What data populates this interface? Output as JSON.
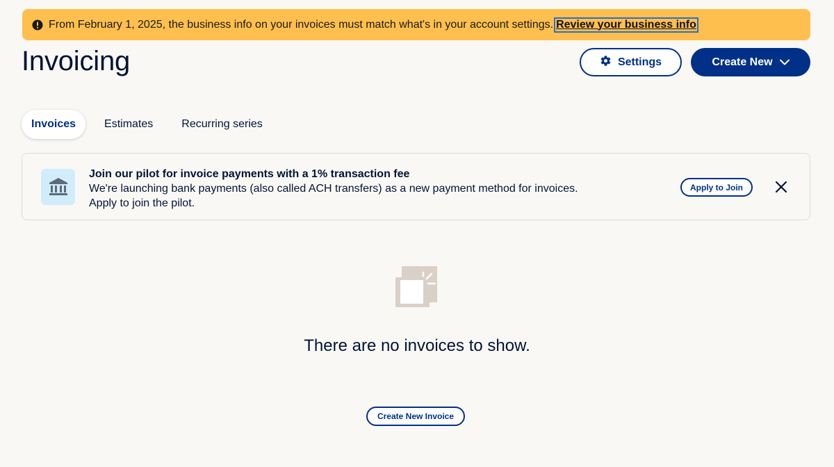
{
  "alert": {
    "message": "From February 1, 2025, the business info on your invoices must match what's in your account settings.",
    "link_label": "Review your business info",
    "icon": "exclamation-circle-icon"
  },
  "header": {
    "title": "Invoicing",
    "settings_label": "Settings",
    "create_label": "Create New"
  },
  "tabs": [
    {
      "label": "Invoices",
      "active": true
    },
    {
      "label": "Estimates",
      "active": false
    },
    {
      "label": "Recurring series",
      "active": false
    }
  ],
  "pilot_card": {
    "icon": "bank-icon",
    "title": "Join our pilot for invoice payments with a 1% transaction fee",
    "body_line1": "We're launching bank payments (also called ACH transfers) as a new payment method for invoices.",
    "body_line2": "Apply to join the pilot.",
    "apply_label": "Apply to Join"
  },
  "empty_state": {
    "icon": "empty-invoice-icon",
    "message": "There are no invoices to show.",
    "button_label": "Create New Invoice"
  },
  "colors": {
    "brand": "#003087",
    "alert_bg": "#ffbf4f",
    "page_bg": "#faf8f5",
    "icon_bg": "#d1ecfb"
  }
}
